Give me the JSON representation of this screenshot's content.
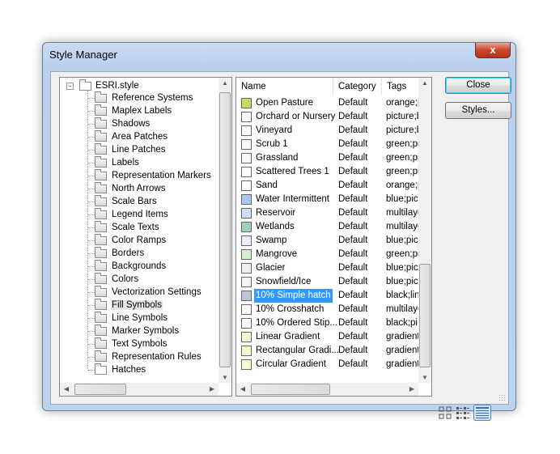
{
  "window": {
    "title": "Style Manager",
    "close_glyph": "x"
  },
  "tree": {
    "root": "ESRI.style",
    "items": [
      "Reference Systems",
      "Maplex Labels",
      "Shadows",
      "Area Patches",
      "Line Patches",
      "Labels",
      "Representation Markers",
      "North Arrows",
      "Scale Bars",
      "Legend Items",
      "Scale Texts",
      "Color Ramps",
      "Borders",
      "Backgrounds",
      "Colors",
      "Vectorization Settings",
      "Fill Symbols",
      "Line Symbols",
      "Marker Symbols",
      "Text Symbols",
      "Representation Rules",
      "Hatches"
    ],
    "selected": "Fill Symbols"
  },
  "list": {
    "columns": [
      "Name",
      "Category",
      "Tags"
    ],
    "rows": [
      {
        "name": "Open Pasture",
        "category": "Default",
        "tags": "orange;p",
        "color": "#c8d860"
      },
      {
        "name": "Orchard or Nursery",
        "category": "Default",
        "tags": "picture;b",
        "color": "#ffffff"
      },
      {
        "name": "Vineyard",
        "category": "Default",
        "tags": "picture;b",
        "color": "#ffffff"
      },
      {
        "name": "Scrub 1",
        "category": "Default",
        "tags": "green;pi",
        "color": "#f4fbf0"
      },
      {
        "name": "Grassland",
        "category": "Default",
        "tags": "green;pi",
        "color": "#f4fbf0"
      },
      {
        "name": "Scattered Trees 1",
        "category": "Default",
        "tags": "green;pi",
        "color": "#ffffff"
      },
      {
        "name": "Sand",
        "category": "Default",
        "tags": "orange;p",
        "color": "#fdfbf4"
      },
      {
        "name": "Water Intermittent",
        "category": "Default",
        "tags": "blue;pict",
        "color": "#a8c8ee"
      },
      {
        "name": "Reservoir",
        "category": "Default",
        "tags": "multilaye",
        "color": "#cfe0f6"
      },
      {
        "name": "Wetlands",
        "category": "Default",
        "tags": "multilaye",
        "color": "#9fd0b8"
      },
      {
        "name": "Swamp",
        "category": "Default",
        "tags": "blue;pict",
        "color": "#e8eefc"
      },
      {
        "name": "Mangrove",
        "category": "Default",
        "tags": "green;pi",
        "color": "#d8f0d0"
      },
      {
        "name": "Glacier",
        "category": "Default",
        "tags": "blue;pict",
        "color": "#e6f2fa"
      },
      {
        "name": "Snowfield/Ice",
        "category": "Default",
        "tags": "blue;pict",
        "color": "#eef6fc"
      },
      {
        "name": "10% Simple hatch",
        "category": "Default",
        "tags": "black;lin",
        "color": "#b8c8d8"
      },
      {
        "name": "10% Crosshatch",
        "category": "Default",
        "tags": "multilaye",
        "color": "#ffffff"
      },
      {
        "name": "10% Ordered Stip...",
        "category": "Default",
        "tags": "black;pi",
        "color": "#ffffff"
      },
      {
        "name": "Linear Gradient",
        "category": "Default",
        "tags": "gradient",
        "color": "#fbf8d0"
      },
      {
        "name": "Rectangular Gradi...",
        "category": "Default",
        "tags": "gradient",
        "color": "#fbf8d0"
      },
      {
        "name": "Circular Gradient",
        "category": "Default",
        "tags": "gradient",
        "color": "#fbf8d0"
      }
    ],
    "selected": "10% Simple hatch"
  },
  "buttons": {
    "close": "Close",
    "styles": "Styles..."
  },
  "view_modes": [
    "large-icons",
    "list",
    "details"
  ],
  "active_view": "details"
}
